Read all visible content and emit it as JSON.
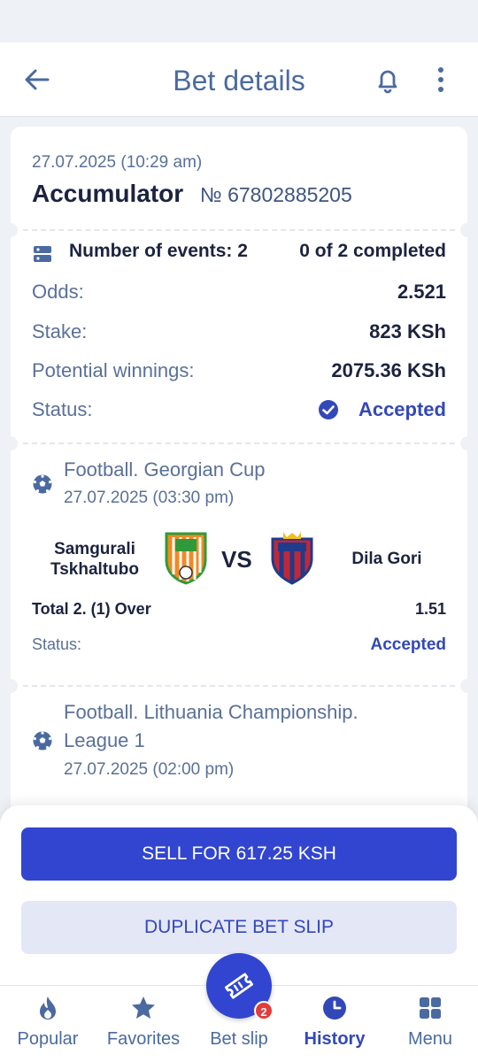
{
  "header": {
    "title": "Bet details"
  },
  "bet": {
    "date": "27.07.2025 (10:29 am)",
    "type": "Accumulator",
    "number": "№ 67802885205",
    "events_label": "Number of events: 2",
    "completed": "0 of 2 completed",
    "odds_label": "Odds:",
    "odds_value": "2.521",
    "stake_label": "Stake:",
    "stake_value": "823 KSh",
    "winnings_label": "Potential winnings:",
    "winnings_value": "2075.36 KSh",
    "status_label": "Status:",
    "status_value": "Accepted"
  },
  "events": [
    {
      "league": "Football. Georgian Cup",
      "date": "27.07.2025 (03:30 pm)",
      "team1": "Samgurali Tskhaltubo",
      "vs": "VS",
      "team2": "Dila Gori",
      "market": "Total 2. (1) Over",
      "coef": "1.51",
      "status_label": "Status:",
      "status_value": "Accepted"
    },
    {
      "league_line1": "Football. Lithuania Championship.",
      "league_line2": "League 1",
      "date": "27.07.2025 (02:00 pm)"
    }
  ],
  "actions": {
    "sell_label": "SELL FOR 617.25 KSH",
    "duplicate_label": "DUPLICATE BET SLIP"
  },
  "nav": {
    "items": [
      {
        "label": "Popular",
        "icon": "flame-icon"
      },
      {
        "label": "Favorites",
        "icon": "star-icon"
      },
      {
        "label": "Bet slip",
        "icon": "ticket-icon",
        "badge": "2"
      },
      {
        "label": "History",
        "icon": "clock-icon"
      },
      {
        "label": "Menu",
        "icon": "grid-icon"
      }
    ],
    "active": "History"
  },
  "colors": {
    "accent": "#3145d0",
    "title": "#4a6aa0",
    "text_dark": "#1c2340",
    "badge": "#e33b3b"
  }
}
